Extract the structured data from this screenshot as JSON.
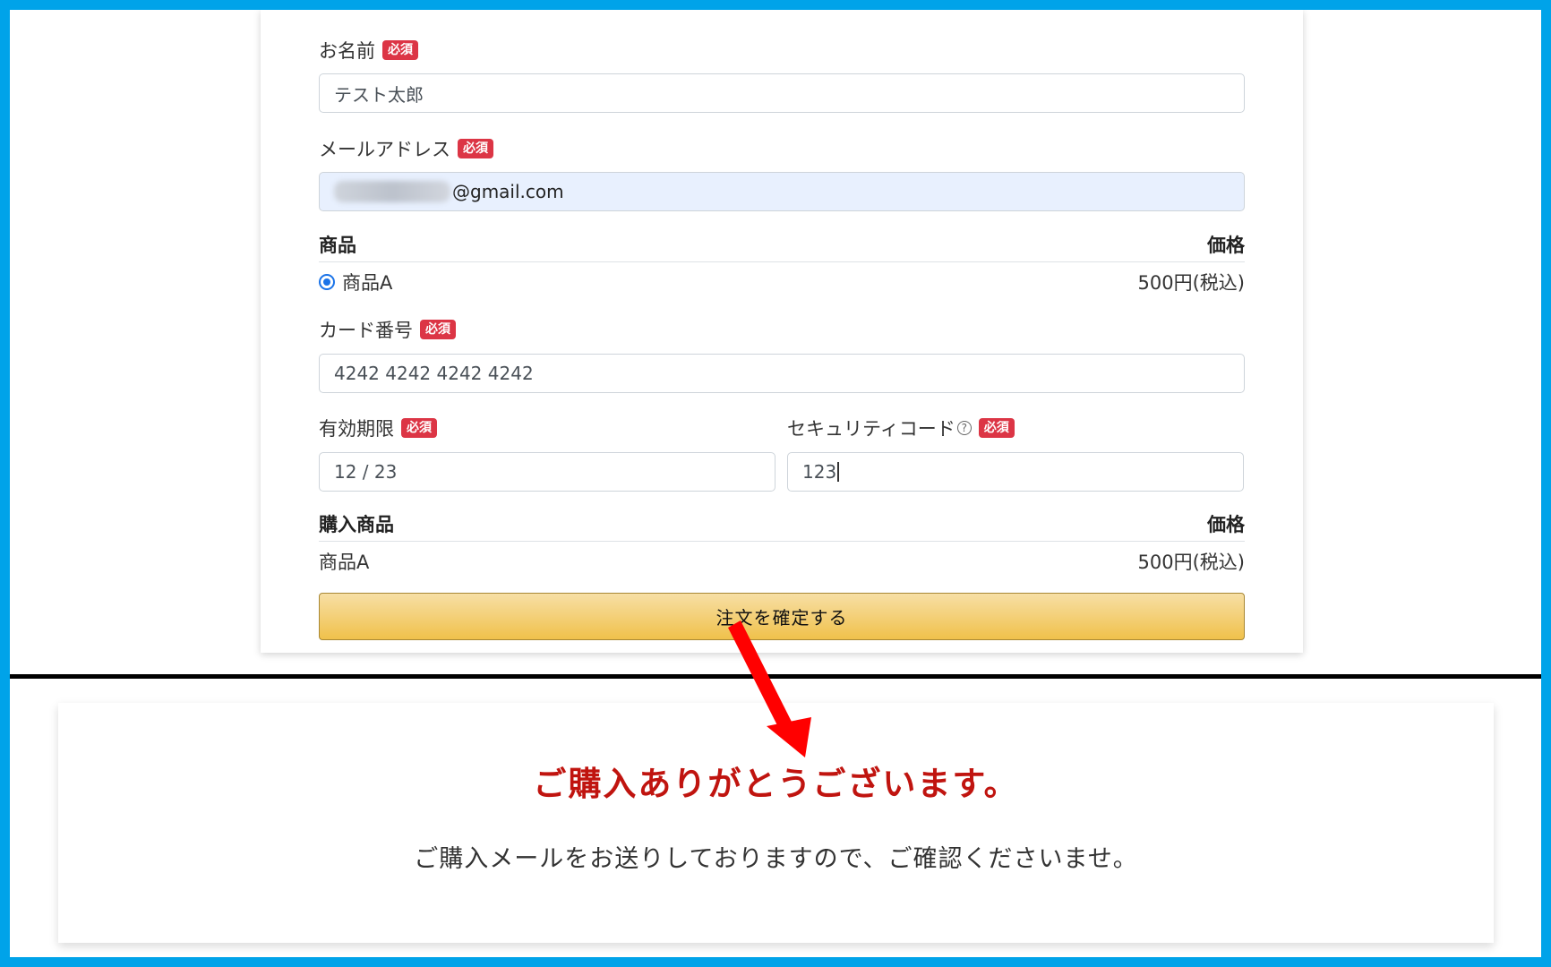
{
  "form": {
    "required_badge": "必須",
    "name": {
      "label": "お名前",
      "value": "テスト太郎"
    },
    "email": {
      "label": "メールアドレス",
      "value_visible": "@gmail.com"
    },
    "product_table": {
      "col_product": "商品",
      "col_price": "価格",
      "row_product": "商品A",
      "row_price": "500円(税込)",
      "selected": true
    },
    "card_number": {
      "label": "カード番号",
      "value": "4242 4242 4242 4242"
    },
    "expiry": {
      "label": "有効期限",
      "value": "12 / 23"
    },
    "security_code": {
      "label": "セキュリティコード",
      "help_icon": "?",
      "value": "123"
    },
    "purchase_table": {
      "col_product": "購入商品",
      "col_price": "価格",
      "row_product": "商品A",
      "row_price": "500円(税込)"
    },
    "confirm_label": "注文を確定する",
    "button_color": "#f0c14b"
  },
  "thanks": {
    "title": "ご購入ありがとうございます。",
    "message": "ご購入メールをお送りしておりますので、ご確認くださいませ。",
    "title_color": "#c0140f"
  },
  "annotation": {
    "arrow_color": "#ff0000",
    "frame_color": "#00a3e9"
  }
}
